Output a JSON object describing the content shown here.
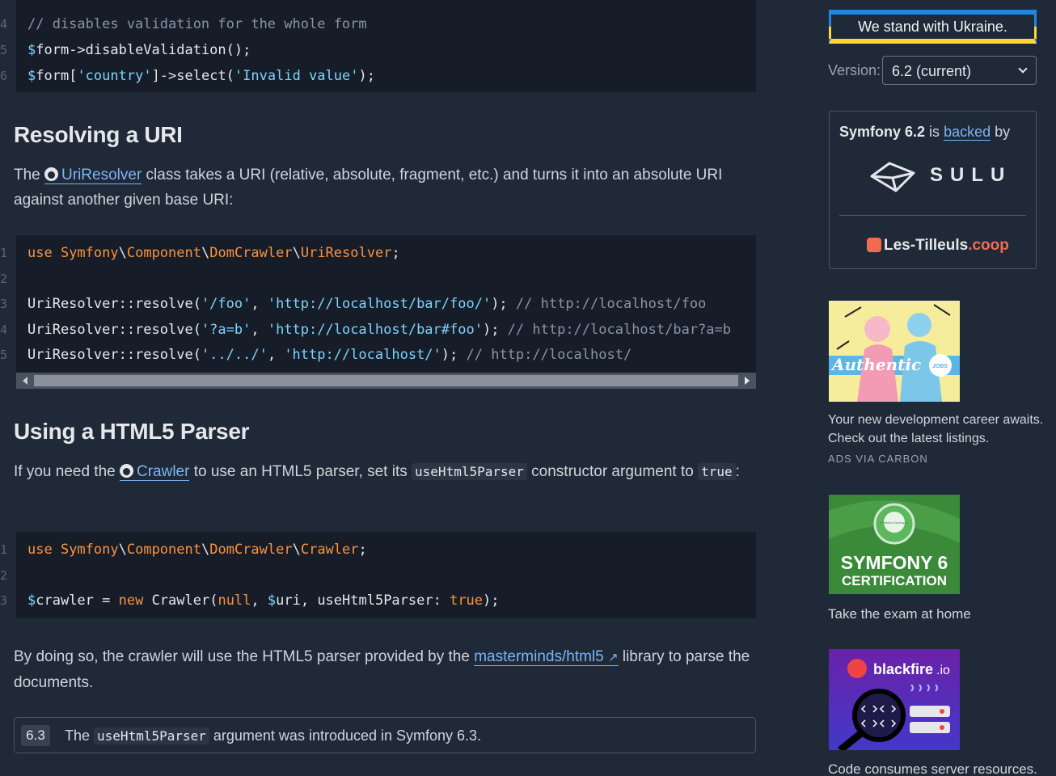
{
  "code_block_1": {
    "line_numbers": [
      "4",
      "5",
      "6"
    ],
    "lines": [
      [
        {
          "t": "// disables validation for the whole form",
          "c": "c-comment"
        }
      ],
      [
        {
          "t": "$",
          "c": "c-dollar"
        },
        {
          "t": "form->disableValidation();",
          "c": "c-plain"
        }
      ],
      [
        {
          "t": "$",
          "c": "c-dollar"
        },
        {
          "t": "form[",
          "c": "c-plain"
        },
        {
          "t": "'country'",
          "c": "c-str"
        },
        {
          "t": "]->select(",
          "c": "c-plain"
        },
        {
          "t": "'Invalid value'",
          "c": "c-str"
        },
        {
          "t": ");",
          "c": "c-plain"
        }
      ]
    ]
  },
  "section_uri": {
    "title": "Resolving a URI",
    "para_prefix": "The ",
    "link": "UriResolver",
    "para_suffix": " class takes a URI (relative, absolute, fragment, etc.) and turns it into an absolute URI against another given base URI:"
  },
  "code_block_2": {
    "line_numbers": [
      "1",
      "2",
      "3",
      "4",
      "5"
    ],
    "lines": [
      [
        {
          "t": "use ",
          "c": "c-kw"
        },
        {
          "t": "Symfony",
          "c": "c-ns"
        },
        {
          "t": "\\",
          "c": "c-plain"
        },
        {
          "t": "Component",
          "c": "c-ns"
        },
        {
          "t": "\\",
          "c": "c-plain"
        },
        {
          "t": "DomCrawler",
          "c": "c-ns"
        },
        {
          "t": "\\",
          "c": "c-plain"
        },
        {
          "t": "UriResolver",
          "c": "c-ns"
        },
        {
          "t": ";",
          "c": "c-plain"
        }
      ],
      [],
      [
        {
          "t": "UriResolver::resolve(",
          "c": "c-plain"
        },
        {
          "t": "'/foo'",
          "c": "c-str"
        },
        {
          "t": ", ",
          "c": "c-plain"
        },
        {
          "t": "'http://localhost/bar/foo/'",
          "c": "c-str"
        },
        {
          "t": "); ",
          "c": "c-plain"
        },
        {
          "t": "// http://localhost/foo",
          "c": "c-comment"
        }
      ],
      [
        {
          "t": "UriResolver::resolve(",
          "c": "c-plain"
        },
        {
          "t": "'?a=b'",
          "c": "c-str"
        },
        {
          "t": ", ",
          "c": "c-plain"
        },
        {
          "t": "'http://localhost/bar#foo'",
          "c": "c-str"
        },
        {
          "t": "); ",
          "c": "c-plain"
        },
        {
          "t": "// http://localhost/bar?a=b",
          "c": "c-comment"
        }
      ],
      [
        {
          "t": "UriResolver::resolve(",
          "c": "c-plain"
        },
        {
          "t": "'../../'",
          "c": "c-str"
        },
        {
          "t": ", ",
          "c": "c-plain"
        },
        {
          "t": "'http://localhost/'",
          "c": "c-str"
        },
        {
          "t": "); ",
          "c": "c-plain"
        },
        {
          "t": "// http://localhost/",
          "c": "c-comment"
        }
      ]
    ]
  },
  "section_html5": {
    "title": "Using a HTML5 Parser",
    "para_prefix": "If you need the ",
    "link": "Crawler",
    "para_mid": " to use an HTML5 parser, set its ",
    "code_arg": "useHtml5Parser",
    "para_mid2": " constructor argument to ",
    "code_true": "true",
    "para_end": ":"
  },
  "code_block_3": {
    "line_numbers": [
      "1",
      "2",
      "3"
    ],
    "lines": [
      [
        {
          "t": "use ",
          "c": "c-kw"
        },
        {
          "t": "Symfony",
          "c": "c-ns"
        },
        {
          "t": "\\",
          "c": "c-plain"
        },
        {
          "t": "Component",
          "c": "c-ns"
        },
        {
          "t": "\\",
          "c": "c-plain"
        },
        {
          "t": "DomCrawler",
          "c": "c-ns"
        },
        {
          "t": "\\",
          "c": "c-plain"
        },
        {
          "t": "Crawler",
          "c": "c-ns"
        },
        {
          "t": ";",
          "c": "c-plain"
        }
      ],
      [],
      [
        {
          "t": "$",
          "c": "c-dollar"
        },
        {
          "t": "crawler = ",
          "c": "c-plain"
        },
        {
          "t": "new ",
          "c": "c-kw"
        },
        {
          "t": "Crawler(",
          "c": "c-plain"
        },
        {
          "t": "null",
          "c": "c-kw"
        },
        {
          "t": ", ",
          "c": "c-plain"
        },
        {
          "t": "$",
          "c": "c-dollar"
        },
        {
          "t": "uri, useHtml5Parser: ",
          "c": "c-plain"
        },
        {
          "t": "true",
          "c": "c-kw"
        },
        {
          "t": ");",
          "c": "c-plain"
        }
      ]
    ]
  },
  "outro": {
    "prefix": "By doing so, the crawler will use the HTML5 parser provided by the ",
    "link": "masterminds/html5",
    "suffix": " library to parse the documents."
  },
  "version_note": {
    "badge": "6.3",
    "prefix": "The ",
    "code": "useHtml5Parser",
    "suffix": " argument was introduced in Symfony 6.3."
  },
  "sidebar": {
    "ukraine": "We stand with Ukraine.",
    "version_label": "Version:",
    "version_value": "6.2 (current)",
    "backers_prefix": "Symfony 6.2",
    "backers_mid": " is ",
    "backers_link": "backed",
    "backers_suffix": " by",
    "sulu": "SULU",
    "tilleuls_main": "Les-Tilleuls",
    "tilleuls_coop": ".coop",
    "ad1_caption": "Your new development career awaits. Check out the latest listings.",
    "ad1_meta": "ADS VIA CARBON",
    "ad1_art_word": "Authentic",
    "ad1_art_badge": "JOBS",
    "ad2_caption": "Take the exam at home",
    "ad2_art_title": "SYMFONY 6",
    "ad2_art_sub": "CERTIFICATION",
    "ad2_art_badge": "Certified Developer",
    "ad3_caption": "Code consumes server resources.",
    "ad3_art_brand": "blackfire",
    "ad3_art_tld": ".io"
  },
  "colors": {
    "background": "#1f2937",
    "code_bg": "#161d29",
    "link": "#7cb4f5",
    "keyword": "#fb923c",
    "string": "#7dd3fc",
    "ukraine_blue": "#1e88e5",
    "ukraine_yellow": "#fdd835"
  }
}
